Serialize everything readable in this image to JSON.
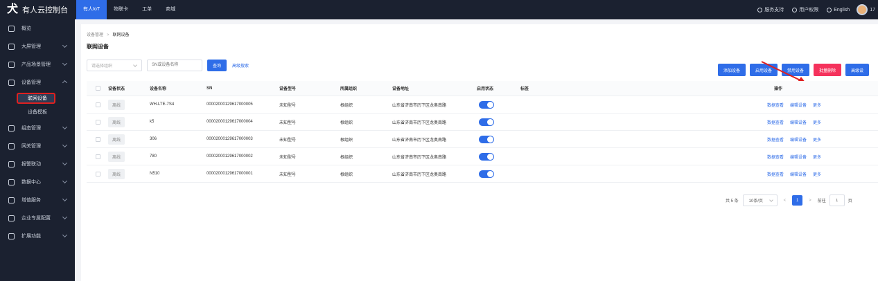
{
  "header": {
    "logo_mark": "犬",
    "title": "有人云控制台",
    "nav": [
      "有人IoT",
      "物联卡",
      "工单",
      "商城"
    ],
    "right": [
      "服务支持",
      "用户权限",
      "English"
    ],
    "user_num": "17"
  },
  "sidebar": {
    "items": [
      {
        "label": "概览",
        "icon": "dashboard-icon"
      },
      {
        "label": "大屏管理",
        "icon": "screen-icon"
      },
      {
        "label": "产品场景管理",
        "icon": "product-icon"
      },
      {
        "label": "设备管理",
        "icon": "device-icon"
      },
      {
        "label": "组态管理",
        "icon": "config-icon"
      },
      {
        "label": "网关管理",
        "icon": "gateway-icon"
      },
      {
        "label": "报警联动",
        "icon": "alarm-icon"
      },
      {
        "label": "数据中心",
        "icon": "chart-icon"
      },
      {
        "label": "增值服务",
        "icon": "service-icon"
      },
      {
        "label": "企业专属配置",
        "icon": "enterprise-icon"
      },
      {
        "label": "扩展功能",
        "icon": "extend-icon"
      }
    ],
    "sub_items": [
      "联网设备",
      "设备模板"
    ]
  },
  "breadcrumb": {
    "parent": "设备管理",
    "current": "联网设备"
  },
  "page_title": "联网设备",
  "filters": {
    "org_placeholder": "请选择组织",
    "search_placeholder": "SN或设备名称",
    "query": "查询",
    "advanced": "高级搜索"
  },
  "actions": [
    "添加设备",
    "启用设备",
    "禁用设备",
    "批量删除",
    "高级设"
  ],
  "accent": "#2f6de8",
  "table": {
    "headers": [
      "设备状态",
      "设备名称",
      "SN",
      "设备型号",
      "所属组织",
      "设备地址",
      "启用状态",
      "标签",
      "操作"
    ],
    "rows": [
      {
        "status": "离线",
        "name": "WH-LTE-7S4",
        "sn": "00002000129617000005",
        "model": "未知型号",
        "org": "根组织",
        "addr": "山东省济南市历下区龙奥南路",
        "ops": [
          "数据查看",
          "编辑设备",
          "更多"
        ]
      },
      {
        "status": "离线",
        "name": "k5",
        "sn": "00002000129617000004",
        "model": "未知型号",
        "org": "根组织",
        "addr": "山东省济南市历下区龙奥南路",
        "ops": [
          "数据查看",
          "编辑设备",
          "更多"
        ]
      },
      {
        "status": "离线",
        "name": "306",
        "sn": "00002000129617000003",
        "model": "未知型号",
        "org": "根组织",
        "addr": "山东省济南市历下区龙奥南路",
        "ops": [
          "数据查看",
          "编辑设备",
          "更多"
        ]
      },
      {
        "status": "离线",
        "name": "780",
        "sn": "00002000129617000002",
        "model": "未知型号",
        "org": "根组织",
        "addr": "山东省济南市历下区龙奥南路",
        "ops": [
          "数据查看",
          "编辑设备",
          "更多"
        ]
      },
      {
        "status": "离线",
        "name": "N510",
        "sn": "00002000129617000001",
        "model": "未知型号",
        "org": "根组织",
        "addr": "山东省济南市历下区龙奥南路",
        "ops": [
          "数据查看",
          "编辑设备",
          "更多"
        ]
      }
    ]
  },
  "pagination": {
    "total": "共 5 条",
    "page_size": "10条/页",
    "current": "1",
    "goto_label": "前往",
    "goto_value": "1",
    "page_suffix": "页"
  }
}
